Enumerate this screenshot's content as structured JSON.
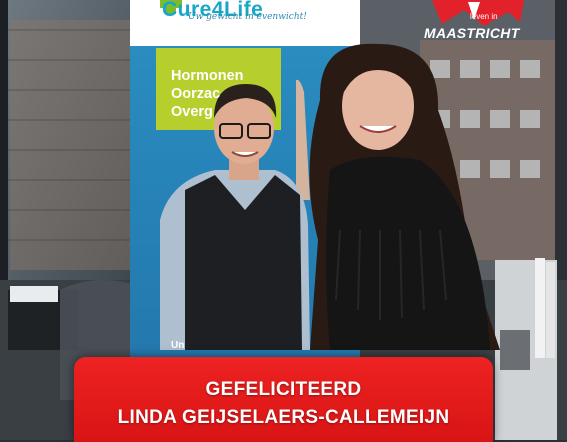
{
  "image": {
    "description_icon": "photo-of-two-people",
    "colors": {
      "caption_red": "#e31b1b",
      "banner_teal": "#1aa6c8",
      "banner_green": "#b7cf2d",
      "logo_red": "#e2212b"
    }
  },
  "banner": {
    "brand": "Cure4Life",
    "tagline": "Uw gewicht in evenwicht!",
    "lines": [
      "Hormonen",
      "Oorzac",
      "Overg"
    ],
    "bottom_text": "Un"
  },
  "logo": {
    "small_text": "leven in",
    "city": "MAASTRICHT",
    "icon": "star-logo-icon"
  },
  "caption": {
    "line1": "GEFELICITEERD",
    "line2": "LINDA GEIJSELAERS-CALLEMEIJN"
  }
}
